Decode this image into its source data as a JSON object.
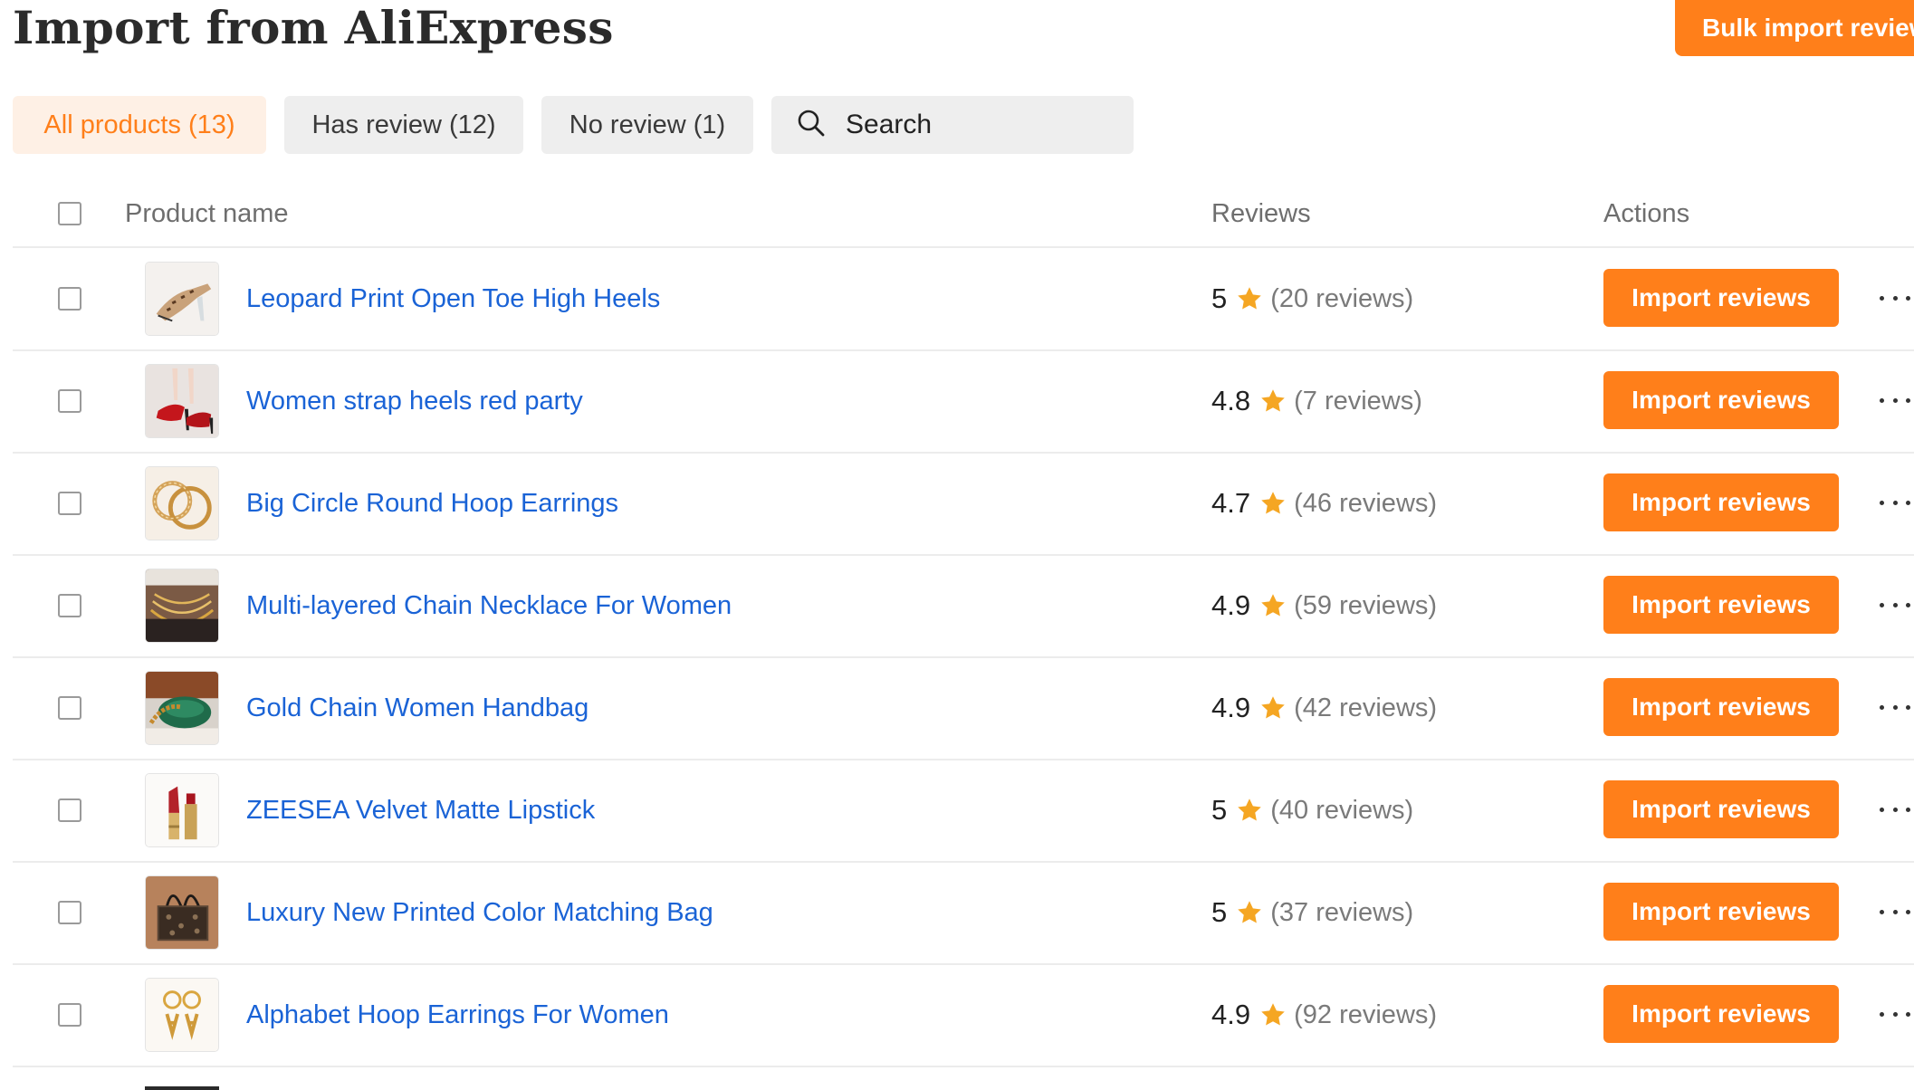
{
  "header": {
    "title": "Import from AliExpress",
    "bulk_button": "Bulk import reviews"
  },
  "filters": {
    "all": "All products (13)",
    "has_review": "Has review (12)",
    "no_review": "No review (1)"
  },
  "search": {
    "placeholder": "Search",
    "value": ""
  },
  "table": {
    "columns": {
      "product": "Product name",
      "reviews": "Reviews",
      "actions": "Actions"
    },
    "action_label": "Import reviews",
    "rows": [
      {
        "name": "Leopard Print Open Toe High Heels",
        "rating": "5",
        "reviews": "(20 reviews)",
        "thumb": "leopard-heels"
      },
      {
        "name": "Women strap heels red party",
        "rating": "4.8",
        "reviews": "(7 reviews)",
        "thumb": "red-heels"
      },
      {
        "name": "Big Circle Round Hoop Earrings",
        "rating": "4.7",
        "reviews": "(46 reviews)",
        "thumb": "hoop-earrings"
      },
      {
        "name": "Multi-layered Chain Necklace For Women",
        "rating": "4.9",
        "reviews": "(59 reviews)",
        "thumb": "chain-necklace"
      },
      {
        "name": "Gold Chain Women Handbag",
        "rating": "4.9",
        "reviews": "(42 reviews)",
        "thumb": "green-handbag"
      },
      {
        "name": "ZEESEA Velvet Matte Lipstick",
        "rating": "5",
        "reviews": "(40 reviews)",
        "thumb": "lipstick"
      },
      {
        "name": "Luxury New Printed Color Matching Bag",
        "rating": "5",
        "reviews": "(37 reviews)",
        "thumb": "printed-bag"
      },
      {
        "name": "Alphabet Hoop Earrings For Women",
        "rating": "4.9",
        "reviews": "(92 reviews)",
        "thumb": "letter-earrings"
      }
    ]
  },
  "colors": {
    "accent": "#ff7f1a",
    "accent_light": "#fef0e5",
    "link": "#1a63d6",
    "star": "#f5a623"
  }
}
